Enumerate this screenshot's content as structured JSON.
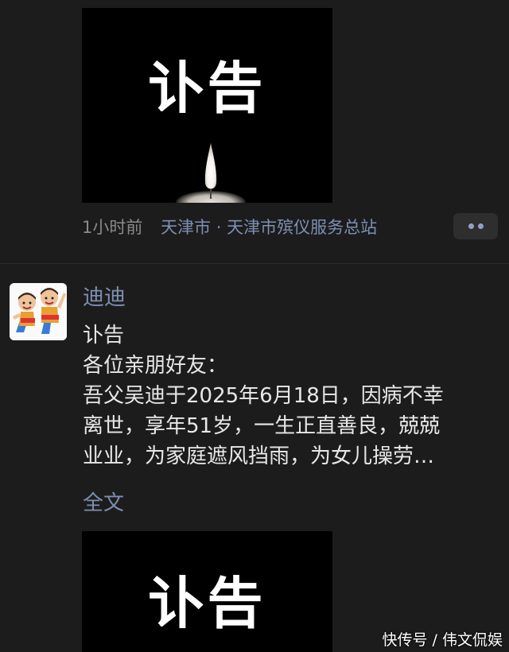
{
  "posts": {
    "previous": {
      "image_title": "讣告",
      "time": "1小时前",
      "location": "天津市 · 天津市殡仪服务总站"
    },
    "current": {
      "author": "迪迪",
      "lines": [
        "讣告",
        "各位亲朋好友：",
        "吾父吴迪于2025年6月18日，因病不幸",
        "离世，享年51岁，一生正直善良，兢兢",
        "业业，为家庭遮风挡雨，为女儿操劳…"
      ],
      "full_text_label": "全文",
      "image_title": "讣告"
    }
  },
  "watermark": "快传号 / 伟文侃娱",
  "colors": {
    "background": "#1c1c1c",
    "link": "#7d8fb3",
    "text": "#e8e8e8",
    "muted": "#8a8a8a"
  },
  "icons": {
    "more": "more-dots-icon",
    "candle": "candle-icon",
    "avatar": "cartoon-avatar-icon"
  }
}
